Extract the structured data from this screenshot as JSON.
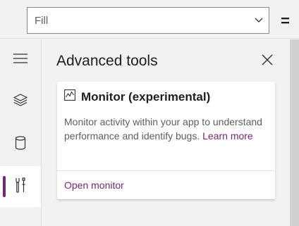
{
  "formula_bar": {
    "property_value": "Fill",
    "equals": "="
  },
  "rail": {
    "items": [
      {
        "icon": "hamburger-icon"
      },
      {
        "icon": "layers-icon"
      },
      {
        "icon": "database-icon"
      },
      {
        "icon": "tools-icon",
        "active": true
      }
    ],
    "accent_color": "#742774"
  },
  "panel": {
    "title": "Advanced tools",
    "card": {
      "icon": "monitor-icon",
      "title": "Monitor (experimental)",
      "description": "Monitor activity within your app to understand performance and identify bugs.",
      "learn_more": "Learn more",
      "action": "Open monitor"
    }
  }
}
